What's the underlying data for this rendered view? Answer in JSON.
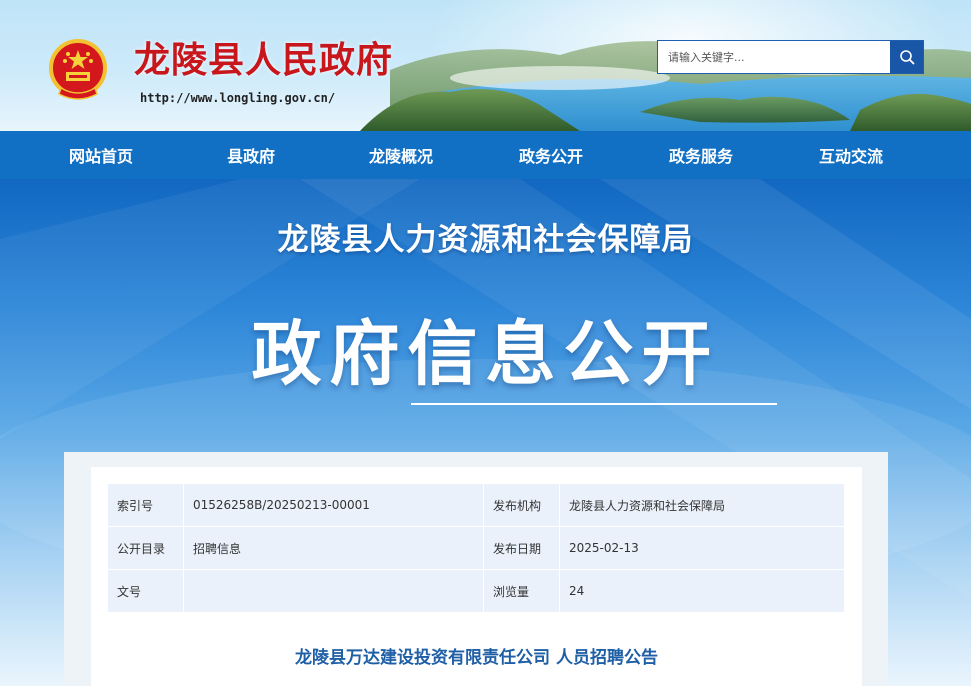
{
  "header": {
    "site_title": "龙陵县人民政府",
    "site_url": "http://www.longling.gov.cn/",
    "emblem_icon": "national-emblem-icon",
    "search": {
      "placeholder": "请输入关键字...",
      "icon": "search-icon"
    }
  },
  "nav": {
    "items": [
      "网站首页",
      "县政府",
      "龙陵概况",
      "政务公开",
      "政务服务",
      "互动交流"
    ]
  },
  "banner": {
    "department": "龙陵县人力资源和社会保障局",
    "heading": "政府信息公开"
  },
  "meta": {
    "index_label": "索引号",
    "index_value": "01526258B/20250213-00001",
    "publisher_label": "发布机构",
    "publisher_value": "龙陵县人力资源和社会保障局",
    "catalog_label": "公开目录",
    "catalog_value": "招聘信息",
    "date_label": "发布日期",
    "date_value": "2025-02-13",
    "docno_label": "文号",
    "docno_value": "",
    "views_label": "浏览量",
    "views_value": "24"
  },
  "article": {
    "title": "龙陵县万达建设投资有限责任公司 人员招聘公告"
  },
  "colors": {
    "site_title": "#c8161d",
    "nav_bg": "#1170c4",
    "search_button": "#1a56a8",
    "article_title": "#1f5fa6",
    "table_bg": "#eaf1fa"
  }
}
